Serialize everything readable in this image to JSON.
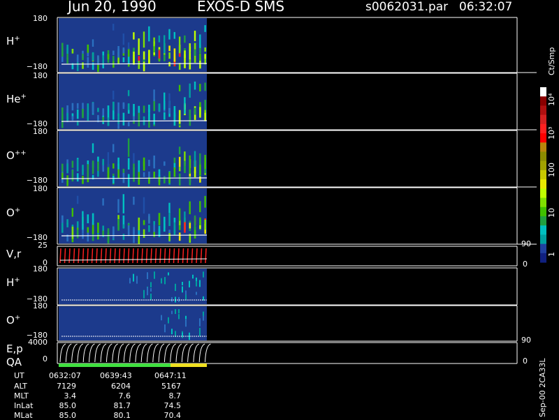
{
  "header": {
    "date": "Jun 20, 1990",
    "instrument": "EXOS-D SMS",
    "file": "s0062031.par",
    "time": "06:32:07"
  },
  "panels": [
    {
      "id": "hplus1",
      "label": "H",
      "sup": "+",
      "top_tick": "180",
      "bottom_tick": "−180",
      "type": "spectrogram"
    },
    {
      "id": "heplus",
      "label": "He",
      "sup": "+",
      "top_tick": "180",
      "bottom_tick": "−180",
      "type": "spectrogram"
    },
    {
      "id": "oplusplus",
      "label": "O",
      "sup": "++",
      "top_tick": "180",
      "bottom_tick": "−180",
      "type": "spectrogram"
    },
    {
      "id": "oplus1",
      "label": "O",
      "sup": "+",
      "top_tick": "180",
      "bottom_tick": "−180",
      "type": "spectrogram"
    },
    {
      "id": "vr",
      "label": "V,r",
      "sup": "",
      "top_tick": "25",
      "bottom_tick": "0",
      "right_top": "90",
      "right_bottom": "0",
      "type": "line"
    },
    {
      "id": "hplus2",
      "label": "H",
      "sup": "+",
      "top_tick": "180",
      "bottom_tick": "−180",
      "type": "spectrogram_sparse"
    },
    {
      "id": "oplus2",
      "label": "O",
      "sup": "+",
      "top_tick": "180",
      "bottom_tick": "−180",
      "type": "spectrogram_sparse"
    },
    {
      "id": "ep",
      "label": "E,p",
      "sup": "",
      "top_tick": "4000",
      "bottom_tick": "0",
      "right_top": "90",
      "right_bottom": "0",
      "type": "line"
    }
  ],
  "qa_label": "QA",
  "colorbar": {
    "unit": "Ct/Smp",
    "ticks": [
      "10⁴",
      "10³",
      "100",
      "10",
      "1"
    ],
    "colors": [
      "#ffffff",
      "#8b0000",
      "#b01010",
      "#d42020",
      "#ff2020",
      "#ff0000",
      "#b8860b",
      "#8b8b00",
      "#a0a000",
      "#c8c800",
      "#e8e800",
      "#c0ff00",
      "#80e000",
      "#40c000",
      "#20a040",
      "#00c0c0",
      "#00a0a0",
      "#2040a0",
      "#102080"
    ]
  },
  "ephemeris": {
    "rows": [
      {
        "label": "UT",
        "values": [
          "0632:07",
          "0639:43",
          "0647:11"
        ]
      },
      {
        "label": "ALT",
        "values": [
          "7129",
          "6204",
          "5167"
        ]
      },
      {
        "label": "MLT",
        "values": [
          "3.4",
          "7.6",
          "8.7"
        ]
      },
      {
        "label": "InLat",
        "values": [
          "85.0",
          "81.7",
          "74.5"
        ]
      },
      {
        "label": "MLat",
        "values": [
          "85.0",
          "80.1",
          "70.4"
        ]
      }
    ]
  },
  "footer_rotated": "Sep-00 2CA33L",
  "colors": {
    "background": "#000000",
    "spectrogram_bg": "#1c3a8c",
    "qa_green": "#40e040",
    "qa_yellow": "#f0e020",
    "vr_line": "#ff2020"
  },
  "chart_data": {
    "type": "heatmap",
    "title": "Jun 20, 1990 EXOS-D SMS",
    "x_time_ticks": [
      "0632:07",
      "0639:43",
      "0647:11"
    ],
    "series": [
      {
        "name": "H+",
        "y_range": [
          -180,
          180
        ]
      },
      {
        "name": "He+",
        "y_range": [
          -180,
          180
        ]
      },
      {
        "name": "O++",
        "y_range": [
          -180,
          180
        ]
      },
      {
        "name": "O+",
        "y_range": [
          -180,
          180
        ]
      },
      {
        "name": "V,r",
        "y_range": [
          0,
          25
        ]
      },
      {
        "name": "H+",
        "y_range": [
          -180,
          180
        ]
      },
      {
        "name": "O+",
        "y_range": [
          -180,
          180
        ]
      },
      {
        "name": "E,p",
        "y_range": [
          0,
          4000
        ]
      }
    ],
    "colorbar_range": [
      1,
      10000
    ],
    "colorbar_scale": "log"
  }
}
